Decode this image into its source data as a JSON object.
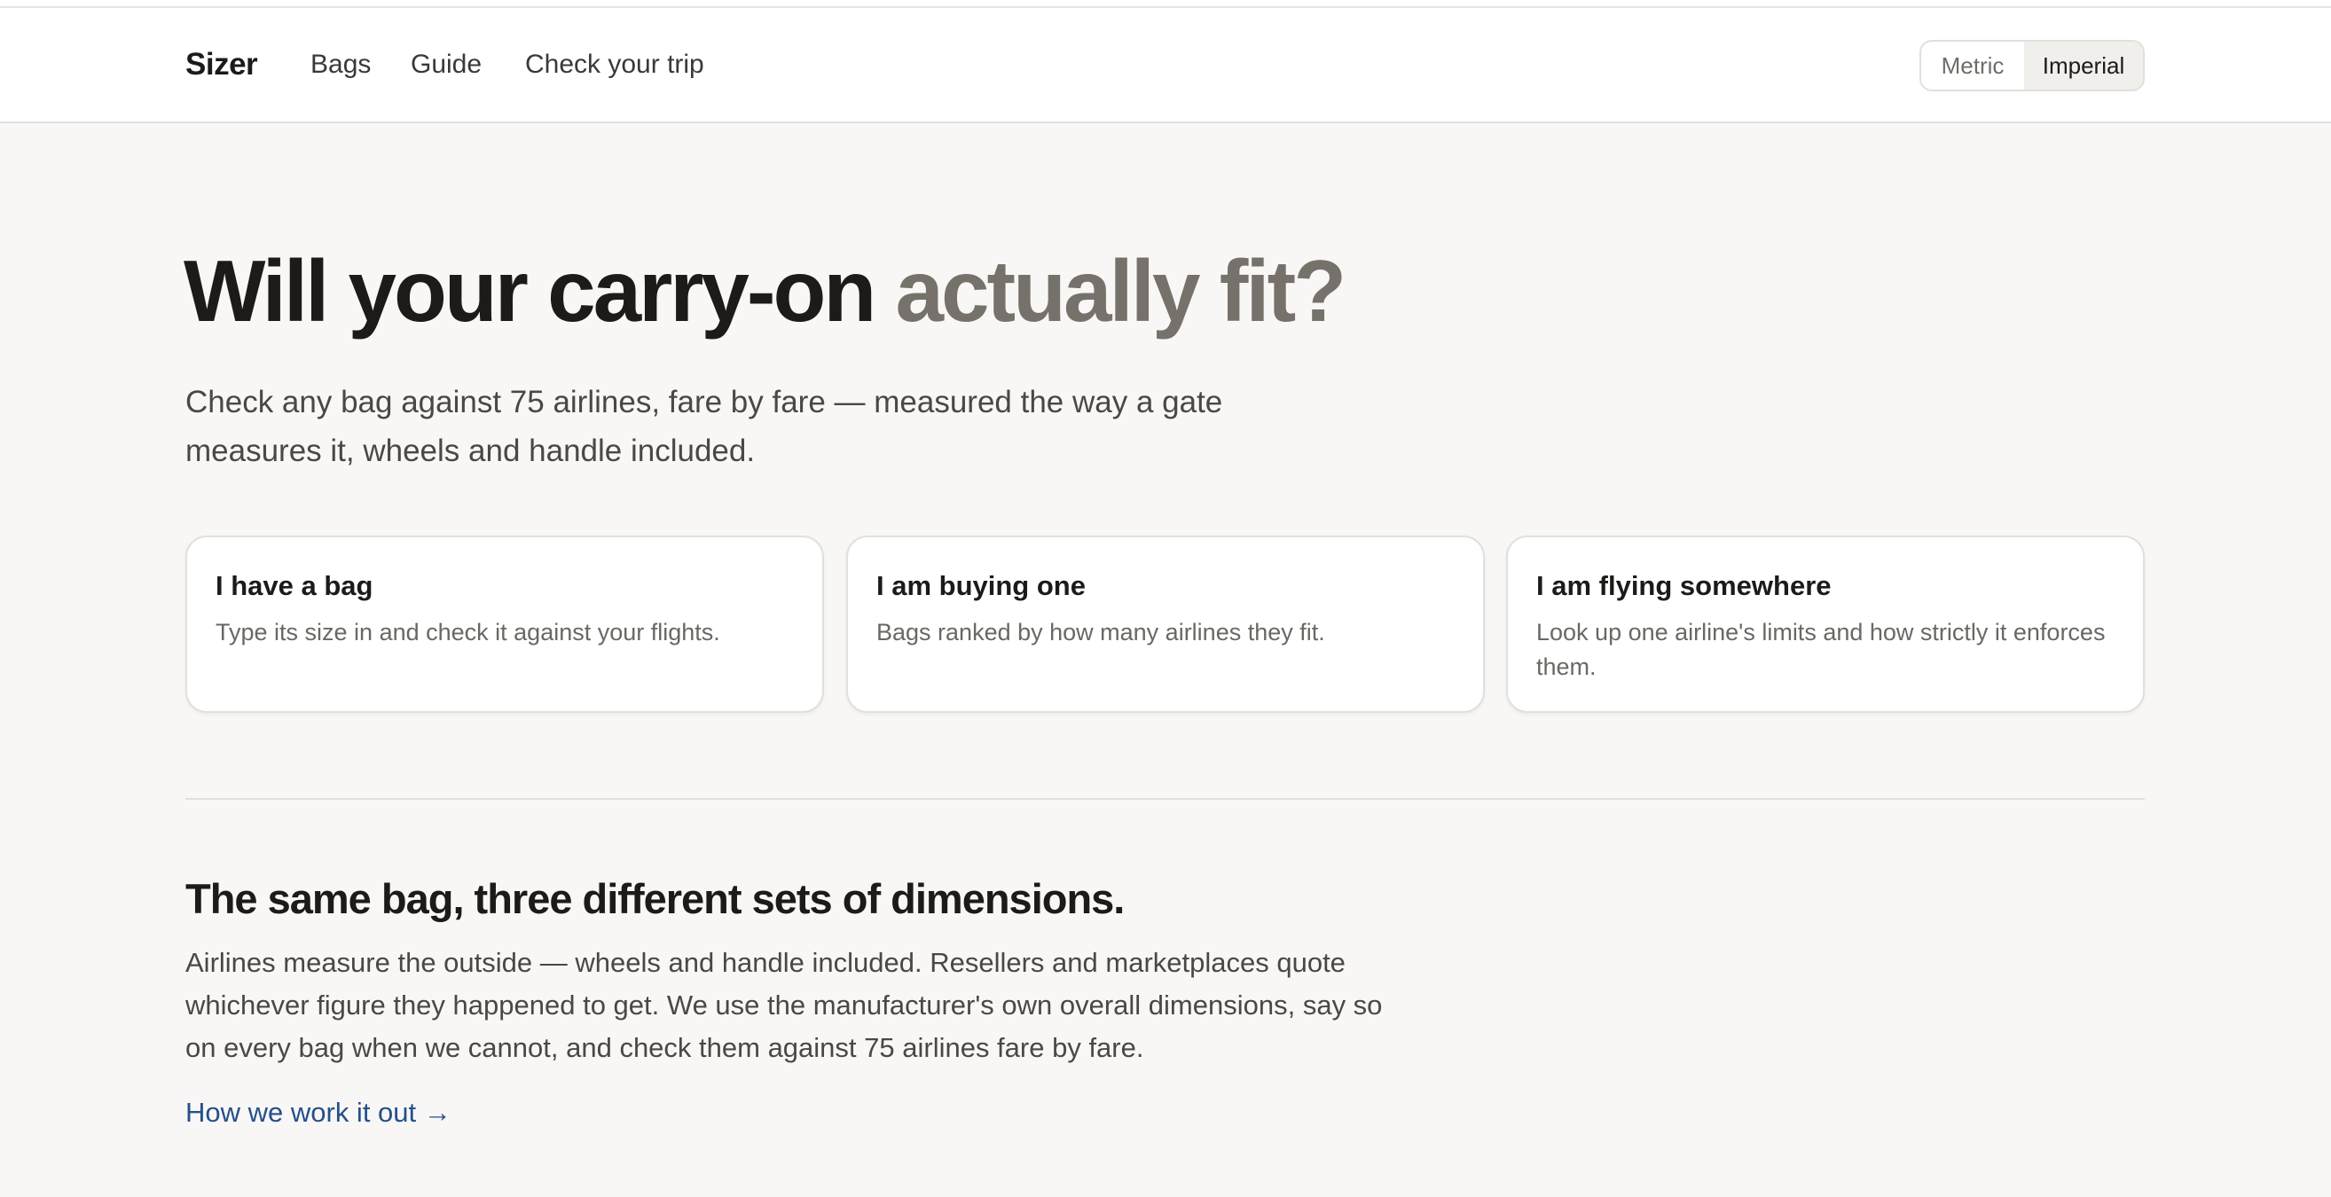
{
  "header": {
    "brand": "Sizer",
    "nav": [
      "Bags",
      "Guide",
      "Check your trip"
    ],
    "units": {
      "options": [
        "Metric",
        "Imperial"
      ],
      "selected": "Imperial"
    }
  },
  "hero": {
    "title_main": "Will your carry-on ",
    "title_accent": "actually fit?",
    "subtitle": "Check any bag against 75 airlines, fare by fare — measured the way a gate measures it, wheels and handle included."
  },
  "cards": [
    {
      "title": "I have a bag",
      "desc": "Type its size in and check it against your flights."
    },
    {
      "title": "I am buying one",
      "desc": "Bags ranked by how many airlines they fit."
    },
    {
      "title": "I am flying somewhere",
      "desc": "Look up one airline's limits and how strictly it enforces them."
    }
  ],
  "section": {
    "title": "The same bag, three different sets of dimensions.",
    "body": "Airlines measure the outside — wheels and handle included. Resellers and marketplaces quote whichever figure they happened to get. We use the manufacturer's own overall dimensions, say so on every bag when we cannot, and check them against 75 airlines fare by fare.",
    "link": "How we work it out →"
  },
  "colors": {
    "accent_text": "#76716b",
    "link": "#25508a",
    "background": "#f8f7f5"
  }
}
